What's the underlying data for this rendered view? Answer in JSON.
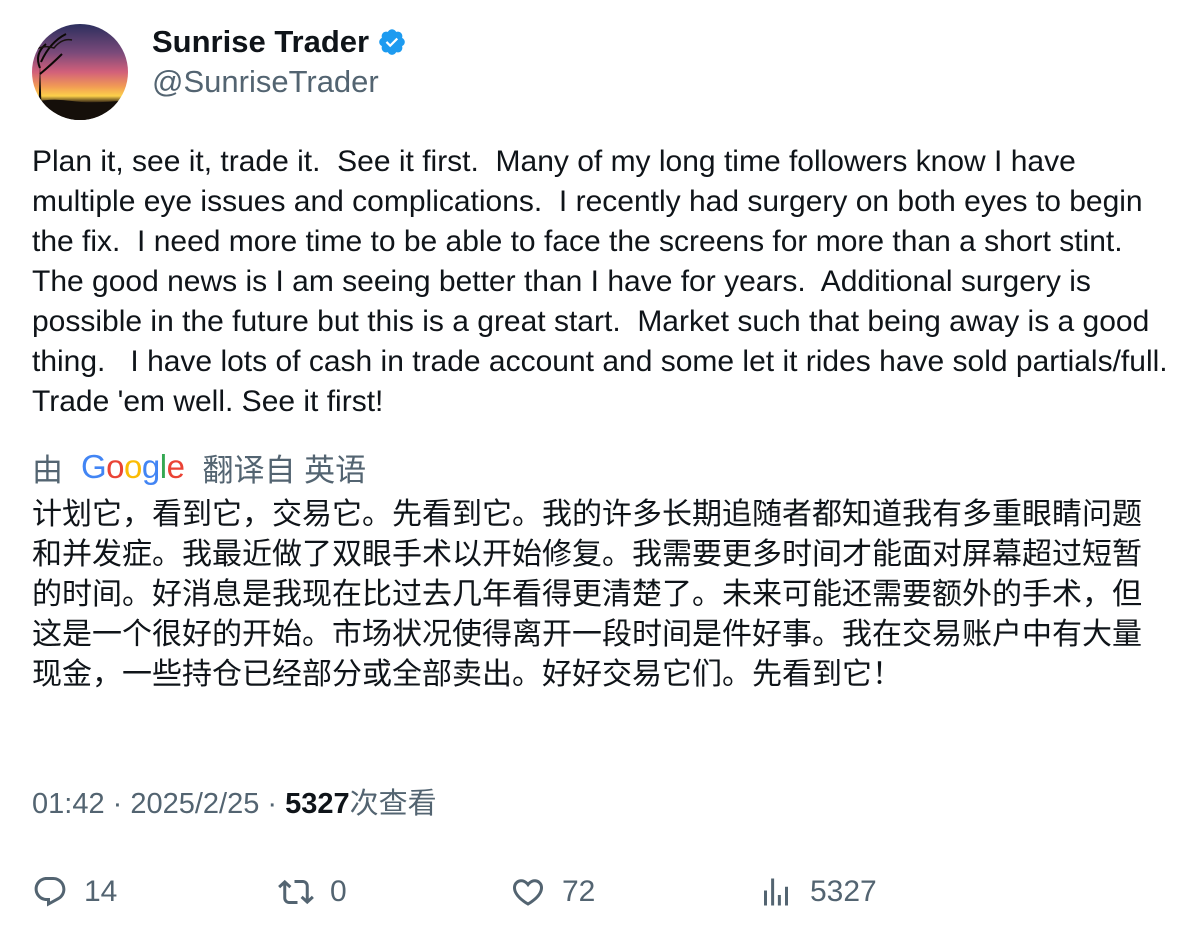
{
  "author": {
    "display_name": "Sunrise Trader",
    "handle": "@SunriseTrader",
    "verified": true,
    "verified_color": "#1d9bf0"
  },
  "tweet": {
    "text": "Plan it, see it, trade it.  See it first.  Many of my long time followers know I have multiple eye issues and complications.  I recently had surgery on both eyes to begin the fix.  I need more time to be able to face the screens for more than a short stint.  The good news is I am seeing better than I have for years.  Additional surgery is possible in the future but this is a great start.  Market such that being away is a good thing.   I have lots of cash in trade account and some let it rides have sold partials/full.  Trade 'em well. See it first!"
  },
  "translation": {
    "prefix": "由",
    "provider_letters": [
      "G",
      "o",
      "o",
      "g",
      "l",
      "e"
    ],
    "suffix": "翻译自 英语",
    "text": "计划它，看到它，交易它。先看到它。我的许多长期追随者都知道我有多重眼睛问题和并发症。我最近做了双眼手术以开始修复。我需要更多时间才能面对屏幕超过短暂的时间。好消息是我现在比过去几年看得更清楚了。未来可能还需要额外的手术，但这是一个很好的开始。市场状况使得离开一段时间是件好事。我在交易账户中有大量现金，一些持仓已经部分或全部卖出。好好交易它们。先看到它！"
  },
  "meta": {
    "time": "01:42",
    "separator": " · ",
    "date": "2025/2/25",
    "views_count": "5327",
    "views_label": "次查看"
  },
  "actions": {
    "replies": "14",
    "retweets": "0",
    "likes": "72",
    "views": "5327"
  },
  "colors": {
    "text_primary": "#0f1419",
    "text_secondary": "#536471",
    "google_blue": "#4285f4",
    "google_red": "#ea4335",
    "google_yellow": "#fbbc05",
    "google_green": "#34a853"
  }
}
